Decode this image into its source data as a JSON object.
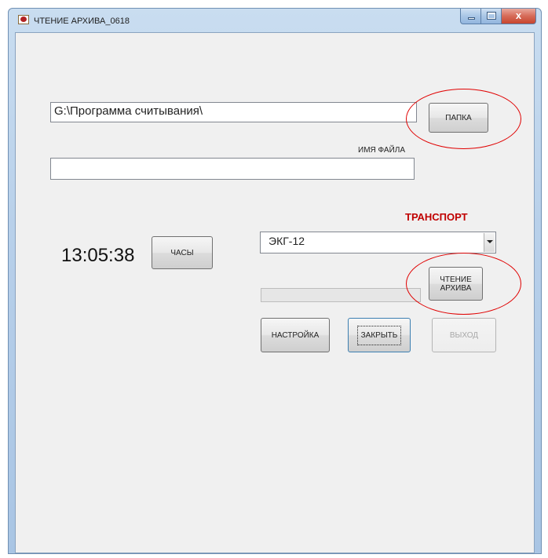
{
  "window": {
    "title": "ЧТЕНИЕ АРХИВА_0618",
    "close_glyph": "x"
  },
  "folder": {
    "path_value": "G:\\Программа считывания\\",
    "folder_button": "ПАПКА"
  },
  "file": {
    "label": "ИМЯ ФАЙЛА",
    "value": ""
  },
  "transport": {
    "label": "ТРАНСПОРТ",
    "selected": "ЭКГ-12"
  },
  "clock": {
    "time": "13:05:38",
    "button": "ЧАСЫ"
  },
  "read_archive": {
    "line1": "ЧТЕНИЕ",
    "line2": "АРХИВА",
    "progress": 0
  },
  "actions": {
    "settings": "НАСТРОЙКА",
    "close": "ЗАКРЫТЬ",
    "exit": "ВЫХОД"
  },
  "colors": {
    "annotation": "#e00000",
    "transport_label": "#c00000"
  }
}
